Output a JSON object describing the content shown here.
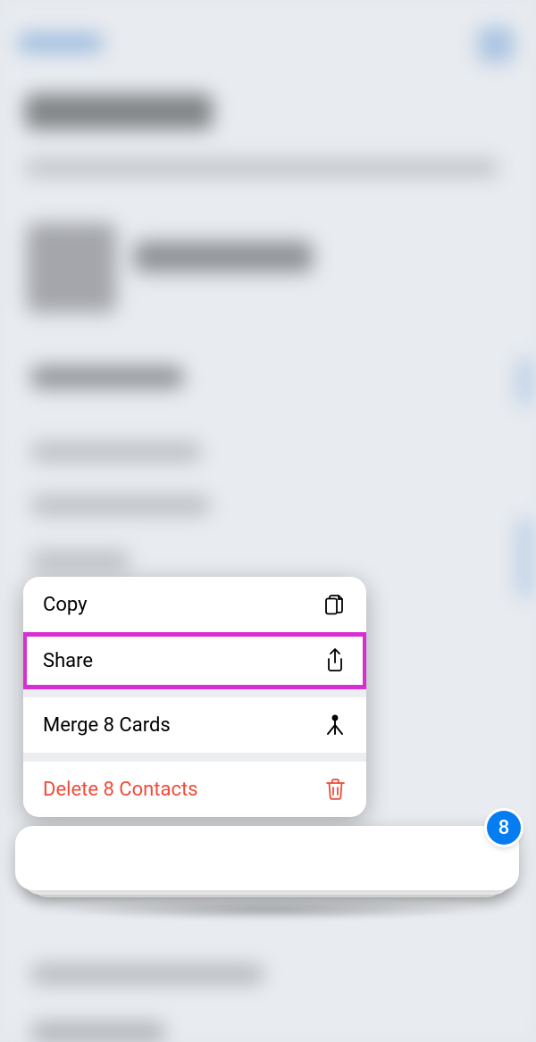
{
  "menu": {
    "copy": {
      "label": "Copy"
    },
    "share": {
      "label": "Share"
    },
    "merge": {
      "label": "Merge 8 Cards"
    },
    "delete": {
      "label": "Delete 8 Contacts"
    }
  },
  "selection": {
    "badge_count": "8"
  },
  "colors": {
    "accent_blue": "#057cf2",
    "danger_red": "#f24a38",
    "highlight_magenta": "#d82fd3"
  }
}
